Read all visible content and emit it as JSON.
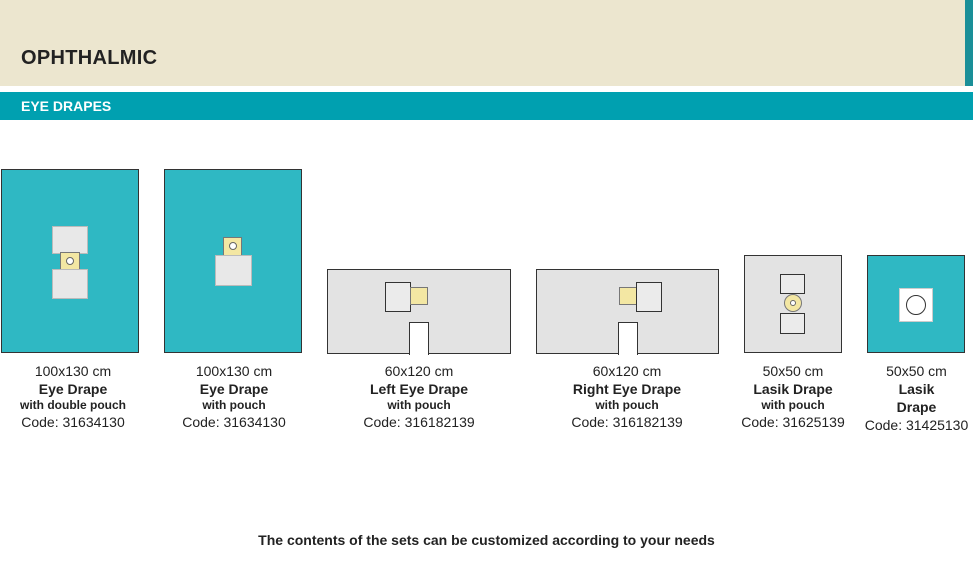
{
  "header": {
    "title": "OPHTHALMIC"
  },
  "band": {
    "label": "EYE DRAPES"
  },
  "products": [
    {
      "size": "100x130 cm",
      "name": "Eye Drape",
      "sub": "with double pouch",
      "code": "Code: 31634130"
    },
    {
      "size": "100x130 cm",
      "name": "Eye Drape",
      "sub": "with pouch",
      "code": "Code: 31634130"
    },
    {
      "size": "60x120 cm",
      "name": "Left Eye Drape",
      "sub": "with pouch",
      "code": "Code: 316182139"
    },
    {
      "size": "60x120 cm",
      "name": "Right Eye Drape",
      "sub": "with pouch",
      "code": "Code: 316182139"
    },
    {
      "size": "50x50 cm",
      "name": "Lasik Drape",
      "sub": "with pouch",
      "code": "Code: 31625139"
    },
    {
      "size": "50x50 cm",
      "name": "Lasik",
      "sub": "Drape",
      "code": "Code: 31425130"
    }
  ],
  "footer": {
    "text": "The contents of the sets can be customized according to your needs"
  },
  "colors": {
    "teal_band": "#00a0b0",
    "drape_teal": "#2fb8c3",
    "header_bg": "#ece6cf"
  }
}
